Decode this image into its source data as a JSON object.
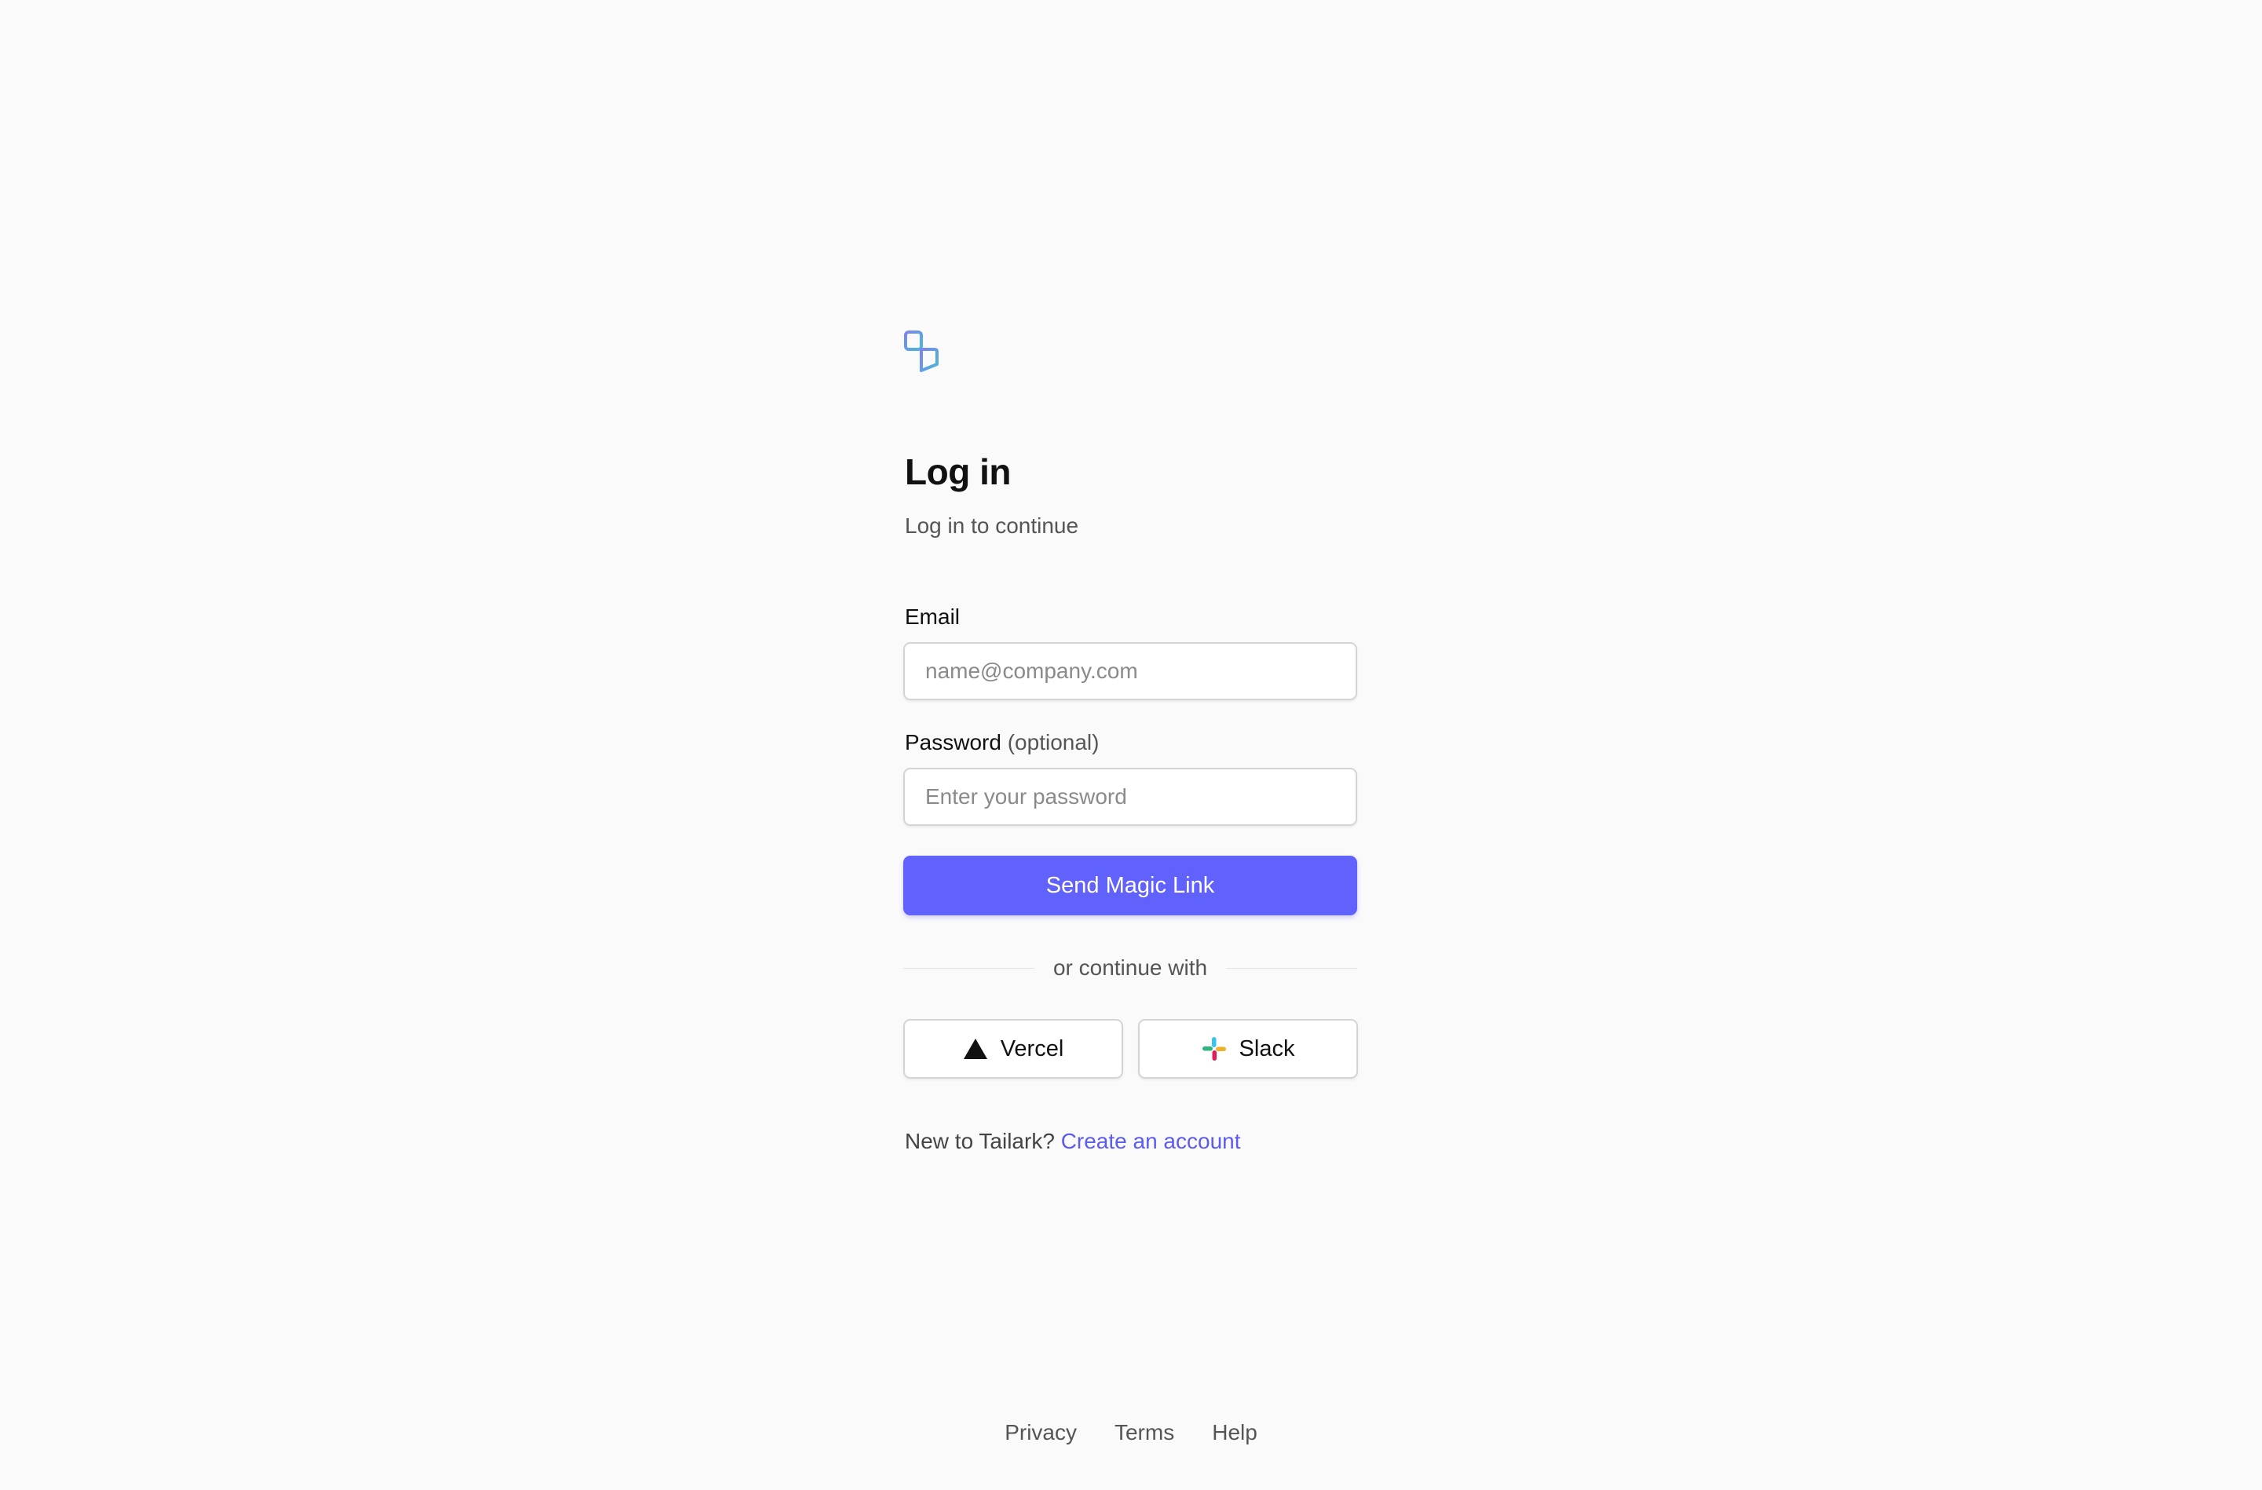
{
  "brand": {
    "logo_icon": "tailark-logo-icon",
    "name": "Tailark"
  },
  "heading": {
    "title": "Log in",
    "subtitle": "Log in to continue"
  },
  "form": {
    "email_label": "Email",
    "email_placeholder": "name@company.com",
    "email_value": "",
    "password_label": "Password",
    "password_optional": "(optional)",
    "password_placeholder": "Enter your password",
    "password_value": "",
    "submit_label": "Send Magic Link"
  },
  "divider_text": "or continue with",
  "social": [
    {
      "label": "Vercel",
      "icon": "vercel-triangle-icon"
    },
    {
      "label": "Slack",
      "icon": "slack-icon"
    }
  ],
  "signup": {
    "prompt": "New to Tailark?",
    "link_label": "Create an account"
  },
  "footer": {
    "links": [
      "Privacy",
      "Terms",
      "Help"
    ]
  },
  "colors": {
    "background": "#fafafa",
    "primary": "#6161fb",
    "link": "#5b5bf0",
    "logo": "#5b9ad8"
  }
}
